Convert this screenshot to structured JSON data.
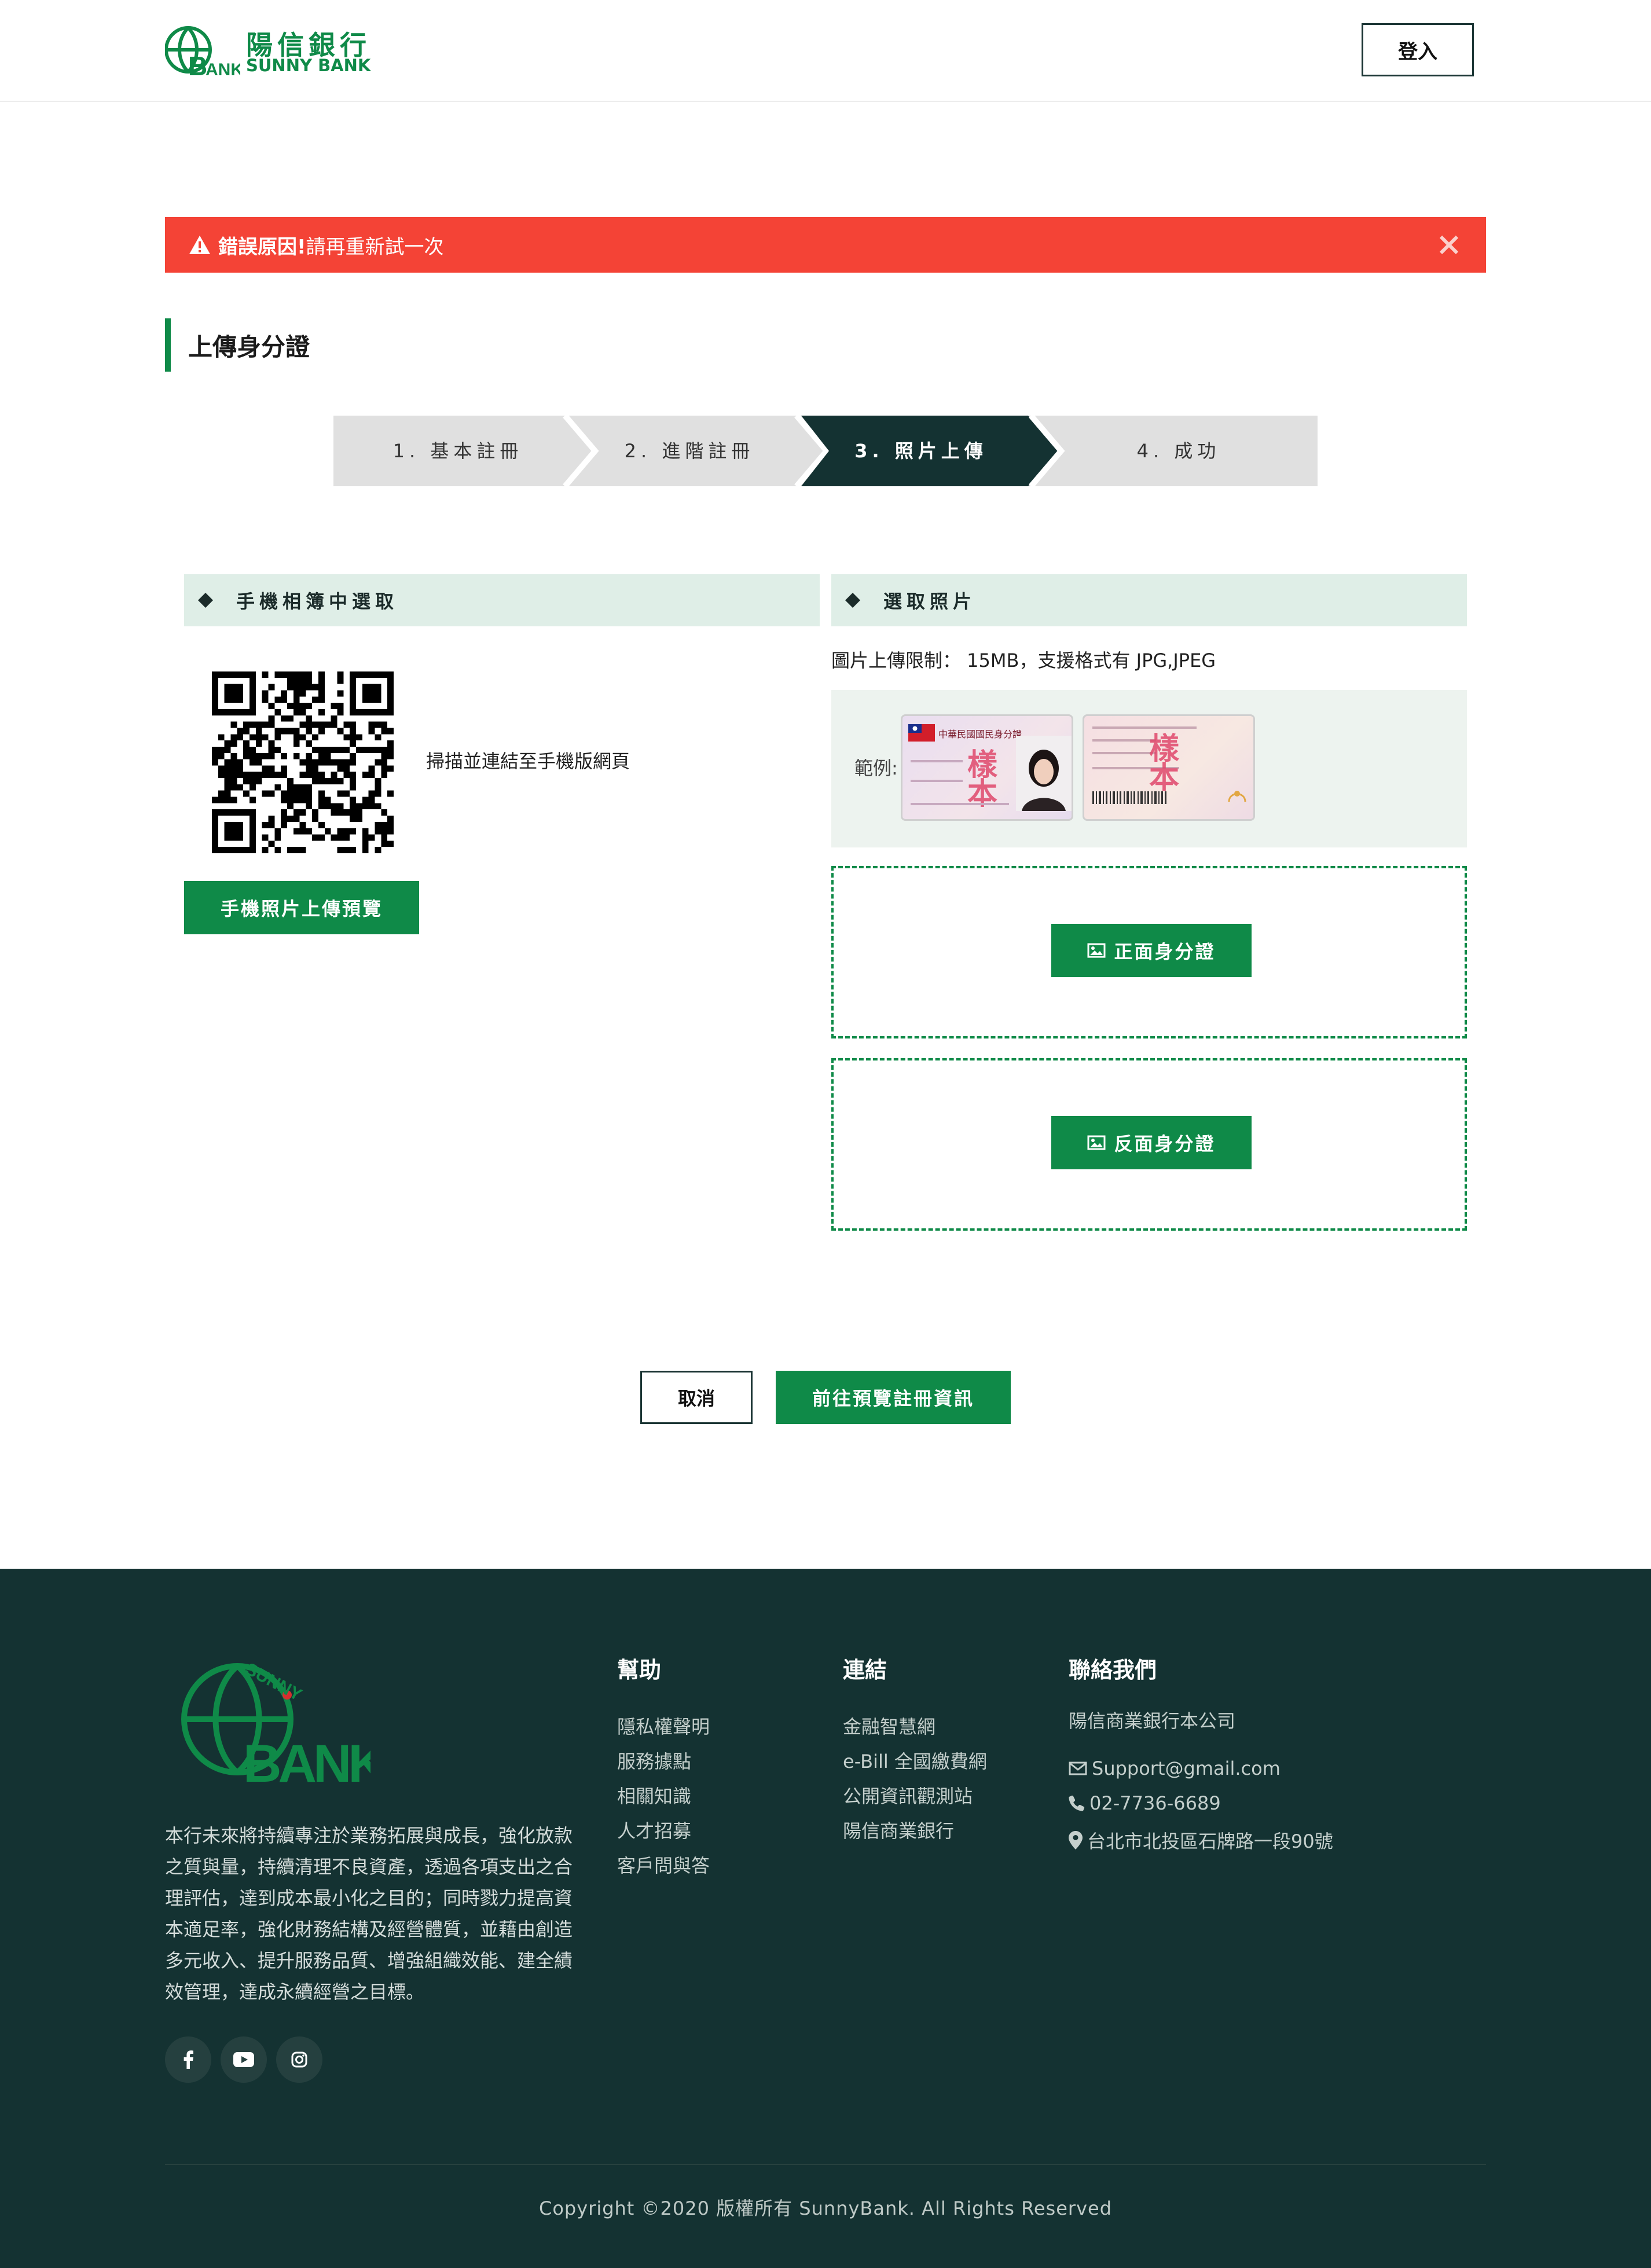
{
  "header": {
    "logo_zh": "陽信銀行",
    "logo_en": "SUNNY BANK",
    "login_label": "登入"
  },
  "alert": {
    "title": "錯誤原因!",
    "message": " 請再重新試一次"
  },
  "page_title": "上傳身分證",
  "steps": [
    {
      "label": "1. 基本註冊",
      "active": false
    },
    {
      "label": "2. 進階註冊",
      "active": false
    },
    {
      "label": "3. 照片上傳",
      "active": true
    },
    {
      "label": "4. 成功",
      "active": false
    }
  ],
  "left_section": {
    "title": "手機相簿中選取",
    "scan_text": "掃描並連結至手機版網頁",
    "preview_button": "手機照片上傳預覽"
  },
  "right_section": {
    "title": "選取照片",
    "limit_text": "圖片上傳限制： 15MB，支援格式有 JPG,JPEG",
    "example_label": "範例:",
    "sample_watermark": "樣本",
    "front_card_title": "中華民國國民身分證",
    "front_button": "正面身分證",
    "back_button": "反面身分證"
  },
  "actions": {
    "cancel": "取消",
    "next": "前往預覽註冊資訊"
  },
  "footer": {
    "logo_top": "SUNNY",
    "logo_bottom": "BANK",
    "about": "本行未來將持續專注於業務拓展與成長，強化放款之質與量，持續清理不良資產，透過各項支出之合理評估，達到成本最小化之目的；同時戮力提高資本適足率，強化財務結構及經營體質，並藉由創造多元收入、提升服務品質、增強組織效能、建全績效管理，達成永續經營之目標。",
    "help": {
      "title": "幫助",
      "links": [
        "隱私權聲明",
        "服務據點",
        "相關知識",
        "人才招募",
        "客戶問與答"
      ]
    },
    "links": {
      "title": "連結",
      "items": [
        "金融智慧網",
        "e-Bill 全國繳費網",
        "公開資訊觀測站",
        "陽信商業銀行"
      ]
    },
    "contact": {
      "title": "聯絡我們",
      "company": "陽信商業銀行本公司",
      "email": "Support@gmail.com",
      "phone": "02-7736-6689",
      "address": "台北市北投區石牌路一段90號"
    },
    "copyright": "Copyright ©2020 版權所有 SunnyBank. All Rights Reserved"
  },
  "colors": {
    "brand_green": "#0f8a48",
    "dark_teal": "#143232",
    "alert_red": "#f44336",
    "section_bg": "#dfeee7"
  }
}
